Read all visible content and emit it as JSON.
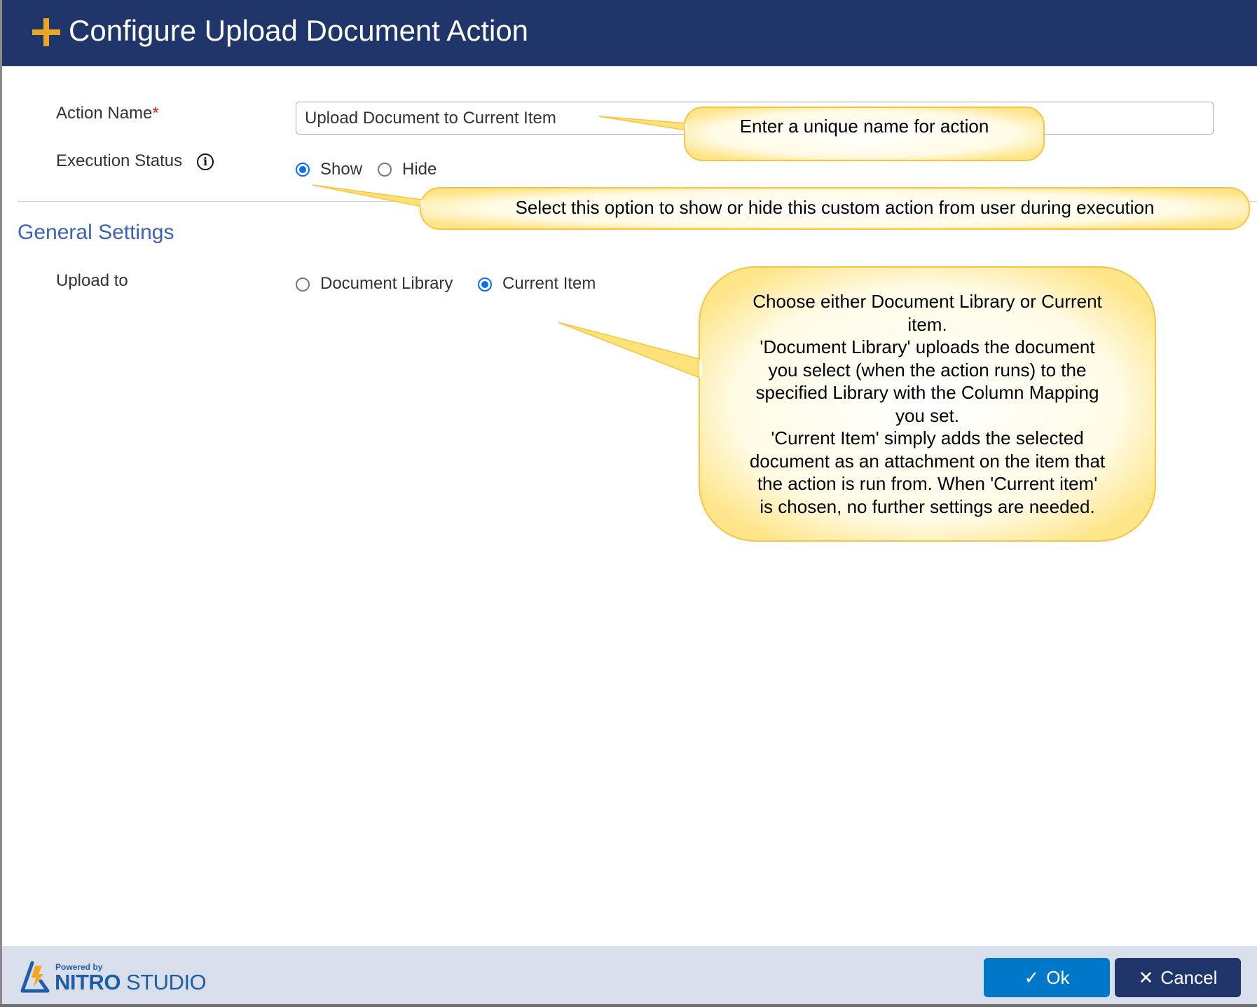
{
  "dialog": {
    "title": "Configure Upload Document Action",
    "title_icon": "plus-icon"
  },
  "form": {
    "action_name": {
      "label": "Action Name",
      "required_marker": "*",
      "value": "Upload Document to Current Item"
    },
    "execution_status": {
      "label": "Execution Status",
      "info_icon": "i",
      "options": [
        {
          "label": "Show",
          "checked": true
        },
        {
          "label": "Hide",
          "checked": false
        }
      ]
    }
  },
  "general_settings": {
    "title": "General Settings",
    "upload_to": {
      "label": "Upload to",
      "options": [
        {
          "label": "Document Library",
          "checked": false
        },
        {
          "label": "Current Item",
          "checked": true
        }
      ]
    }
  },
  "callouts": {
    "action_name": "Enter a unique name for action",
    "execution_status": "Select this option to show or hide this custom action from user during execution",
    "upload_to": [
      "Choose either Document Library or Current",
      "item.",
      "'Document Library' uploads the document",
      "you select (when the action runs) to the",
      "specified Library with the Column Mapping",
      "you set.",
      "'Current Item' simply adds the selected",
      "document as an attachment on the item that",
      "the action is run from. When 'Current item'",
      "is chosen, no further settings are needed."
    ],
    "colors": {
      "fill": "#fff6c8",
      "border": "#f7c544"
    }
  },
  "footer": {
    "powered_by": "Powered by",
    "brand_bold": "NITRO",
    "brand_light": " STUDIO",
    "ok_label": "Ok",
    "cancel_label": "Cancel",
    "ok_icon": "✓",
    "cancel_icon": "✕"
  },
  "colors": {
    "header_bg": "#20366b",
    "accent": "#e6a723",
    "ok_button": "#0077c8",
    "cancel_button": "#20366b",
    "section_title": "#3a63b6",
    "radio_checked": "#0a6cf2"
  }
}
